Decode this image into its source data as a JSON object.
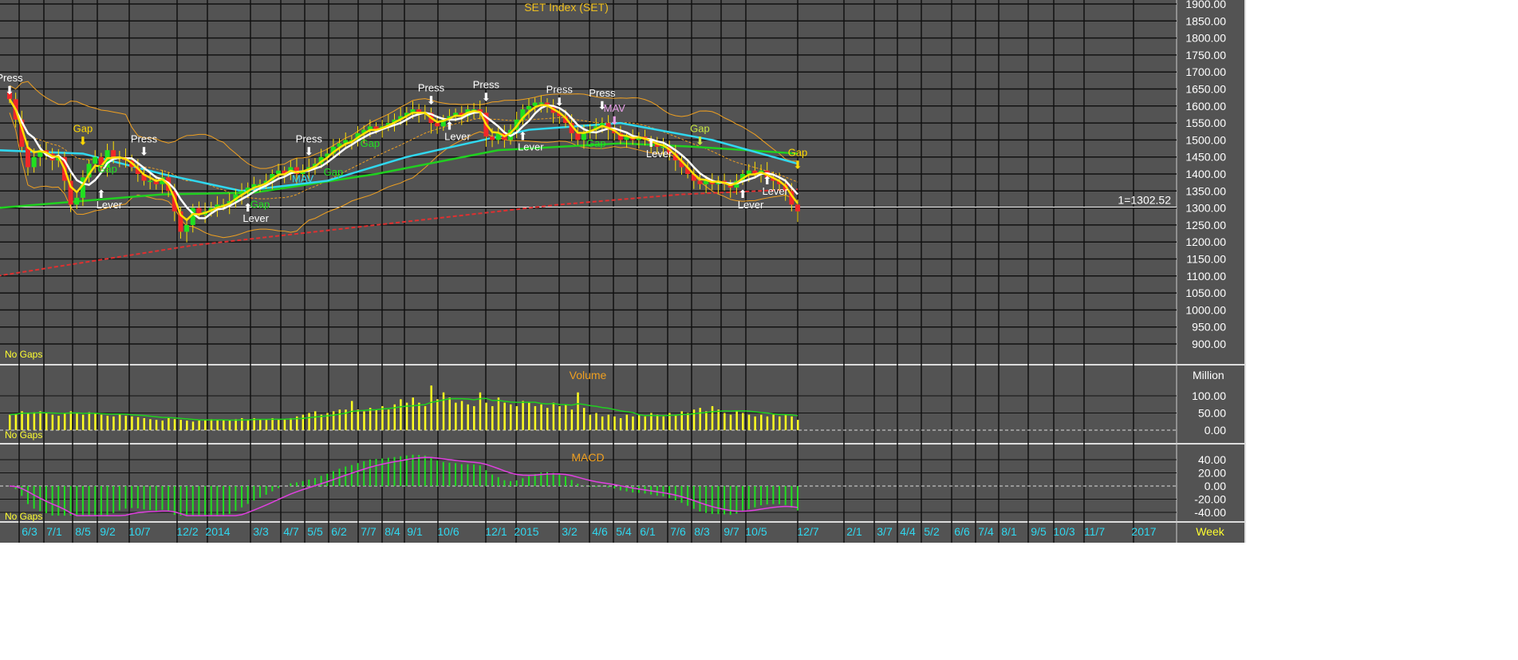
{
  "chart_data": {
    "type": "candlestick",
    "title": "SET Index (SET)",
    "period": "Week",
    "price_axis": {
      "ticks": [
        "900.00",
        "950.00",
        "1000.00",
        "1050.00",
        "1100.00",
        "1150.00",
        "1200.00",
        "1250.00",
        "1300.00",
        "1350.00",
        "1400.00",
        "1450.00",
        "1500.00",
        "1550.00",
        "1600.00",
        "1650.00",
        "1700.00",
        "1750.00",
        "1800.00",
        "1850.00",
        "1900.00"
      ],
      "range": [
        870,
        1905
      ]
    },
    "reference_line": {
      "value": 1302.52,
      "label": "1=1302.52"
    },
    "gaps_label": "No Gaps",
    "closes": [
      1620,
      1560,
      1480,
      1420,
      1450,
      1470,
      1460,
      1440,
      1450,
      1380,
      1310,
      1330,
      1390,
      1430,
      1450,
      1420,
      1470,
      1450,
      1450,
      1440,
      1420,
      1400,
      1380,
      1380,
      1370,
      1390,
      1350,
      1290,
      1230,
      1250,
      1300,
      1280,
      1290,
      1300,
      1310,
      1310,
      1320,
      1340,
      1350,
      1360,
      1370,
      1370,
      1380,
      1400,
      1410,
      1400,
      1420,
      1400,
      1410,
      1420,
      1430,
      1450,
      1460,
      1480,
      1490,
      1500,
      1500,
      1520,
      1530,
      1540,
      1530,
      1540,
      1550,
      1560,
      1570,
      1580,
      1590,
      1580,
      1580,
      1550,
      1540,
      1560,
      1570,
      1580,
      1570,
      1590,
      1590,
      1580,
      1510,
      1500,
      1520,
      1500,
      1530,
      1560,
      1590,
      1600,
      1610,
      1610,
      1600,
      1580,
      1570,
      1550,
      1520,
      1500,
      1520,
      1530,
      1540,
      1550,
      1530,
      1520,
      1500,
      1510,
      1500,
      1510,
      1500,
      1490,
      1480,
      1480,
      1460,
      1440,
      1420,
      1400,
      1380,
      1370,
      1380,
      1370,
      1380,
      1370,
      1360,
      1380,
      1400,
      1410,
      1400,
      1410,
      1390,
      1380,
      1370,
      1350,
      1310,
      1290
    ],
    "first_open": 1640,
    "overlays": [
      {
        "name": "long-ma",
        "color": "#e03030",
        "dashed": true,
        "points": [
          [
            -2,
            1100
          ],
          [
            30,
            1190
          ],
          [
            60,
            1250
          ],
          [
            90,
            1310
          ],
          [
            110,
            1340
          ],
          [
            129,
            1355
          ]
        ]
      },
      {
        "name": "green-ma",
        "color": "#20d020",
        "points": [
          [
            -2,
            1300
          ],
          [
            25,
            1340
          ],
          [
            40,
            1345
          ],
          [
            60,
            1400
          ],
          [
            80,
            1470
          ],
          [
            100,
            1490
          ],
          [
            112,
            1480
          ],
          [
            129,
            1460
          ]
        ]
      },
      {
        "name": "cyan-ma",
        "color": "#30d8f0",
        "points": [
          [
            -2,
            1470
          ],
          [
            12,
            1460
          ],
          [
            25,
            1400
          ],
          [
            38,
            1350
          ],
          [
            52,
            1380
          ],
          [
            65,
            1450
          ],
          [
            85,
            1530
          ],
          [
            100,
            1550
          ],
          [
            115,
            1500
          ],
          [
            129,
            1430
          ]
        ]
      }
    ],
    "annotations": [
      {
        "i": 0,
        "p": 1640,
        "label": "Press",
        "dir": "down",
        "color": "#ffffff"
      },
      {
        "i": 12,
        "p": 1490,
        "label": "Gap",
        "dir": "down",
        "color": "#ffd800"
      },
      {
        "i": 15,
        "p": 1330,
        "label": "Lever",
        "dir": "up",
        "color": "#ffffff"
      },
      {
        "i": 16,
        "p": 1405,
        "label": "Gap",
        "dir": "none",
        "color": "#20e020"
      },
      {
        "i": 22,
        "p": 1460,
        "label": "Press",
        "dir": "down",
        "color": "#ffffff"
      },
      {
        "i": 39,
        "p": 1290,
        "label": "Lever",
        "dir": "up",
        "color": "#ffffff"
      },
      {
        "i": 41,
        "p": 1300,
        "label": "Gap",
        "dir": "none",
        "color": "#20e020"
      },
      {
        "i": 48,
        "p": 1375,
        "label": "MAV",
        "dir": "none",
        "color": "#30d8f0"
      },
      {
        "i": 49,
        "p": 1460,
        "label": "Press",
        "dir": "down",
        "color": "#ffffff"
      },
      {
        "i": 53,
        "p": 1395,
        "label": "Gap",
        "dir": "none",
        "color": "#20e020"
      },
      {
        "i": 59,
        "p": 1480,
        "label": "Gap",
        "dir": "none",
        "color": "#20e020"
      },
      {
        "i": 69,
        "p": 1610,
        "label": "Press",
        "dir": "down",
        "color": "#ffffff"
      },
      {
        "i": 72,
        "p": 1530,
        "label": "Lever",
        "dir": "up",
        "color": "#ffffff"
      },
      {
        "i": 78,
        "p": 1620,
        "label": "Press",
        "dir": "down",
        "color": "#ffffff"
      },
      {
        "i": 84,
        "p": 1500,
        "label": "Lever",
        "dir": "up",
        "color": "#ffffff"
      },
      {
        "i": 90,
        "p": 1605,
        "label": "Press",
        "dir": "down",
        "color": "#ffffff"
      },
      {
        "i": 96,
        "p": 1480,
        "label": "Gap",
        "dir": "none",
        "color": "#20e020"
      },
      {
        "i": 97,
        "p": 1595,
        "label": "Press",
        "dir": "down",
        "color": "#ffffff"
      },
      {
        "i": 99,
        "p": 1550,
        "label": "MAV",
        "dir": "down",
        "color": "#e8a0e8"
      },
      {
        "i": 105,
        "p": 1480,
        "label": "Lever",
        "dir": "up",
        "color": "#ffffff"
      },
      {
        "i": 113,
        "p": 1490,
        "label": "Gap",
        "dir": "down",
        "color": "#c8e840"
      },
      {
        "i": 120,
        "p": 1330,
        "label": "Lever",
        "dir": "up",
        "color": "#ffffff"
      },
      {
        "i": 124,
        "p": 1370,
        "label": "Lever",
        "dir": "up",
        "color": "#ffffff"
      },
      {
        "i": 129,
        "p": 1420,
        "label": "Gap",
        "dir": "down",
        "color": "#ffd800"
      }
    ],
    "volume": {
      "title": "Volume",
      "unit": "Million",
      "ticks": [
        "0.00",
        "50.00",
        "100.00"
      ],
      "values": [
        45,
        48,
        55,
        50,
        52,
        55,
        50,
        45,
        42,
        48,
        55,
        50,
        45,
        52,
        48,
        45,
        42,
        40,
        45,
        42,
        40,
        38,
        35,
        32,
        30,
        28,
        35,
        32,
        30,
        28,
        25,
        28,
        30,
        32,
        30,
        30,
        28,
        32,
        35,
        30,
        35,
        32,
        30,
        35,
        30,
        32,
        35,
        40,
        45,
        50,
        55,
        45,
        50,
        55,
        60,
        60,
        85,
        60,
        55,
        65,
        60,
        70,
        60,
        75,
        90,
        80,
        95,
        80,
        70,
        130,
        90,
        110,
        95,
        80,
        85,
        75,
        70,
        110,
        80,
        70,
        95,
        80,
        75,
        70,
        85,
        80,
        70,
        75,
        65,
        80,
        70,
        75,
        60,
        110,
        65,
        45,
        50,
        40,
        45,
        40,
        35,
        45,
        40,
        45,
        40,
        50,
        45,
        40,
        50,
        45,
        55,
        50,
        60,
        65,
        55,
        70,
        60,
        50,
        45,
        55,
        50,
        45,
        40,
        45,
        40,
        45,
        40,
        45,
        40,
        30
      ]
    },
    "macd": {
      "title": "MACD",
      "ticks": [
        "-40.00",
        "-20.00",
        "0.00",
        "20.00",
        "40.00"
      ]
    },
    "x_labels": [
      "6/3",
      "7/1",
      "8/5",
      "9/2",
      "10/7",
      "12/2",
      "2014",
      "3/3",
      "4/7",
      "5/5",
      "6/2",
      "7/7",
      "8/4",
      "9/1",
      "10/6",
      "12/1",
      "2015",
      "3/2",
      "4/6",
      "5/4",
      "6/1",
      "7/6",
      "8/3",
      "9/7",
      "10/5",
      "12/7",
      "2/1",
      "3/7",
      "4/4",
      "5/2",
      "6/6",
      "7/4",
      "8/1",
      "9/5",
      "10/3",
      "11/7",
      "2017"
    ],
    "x_unit": "Week"
  }
}
